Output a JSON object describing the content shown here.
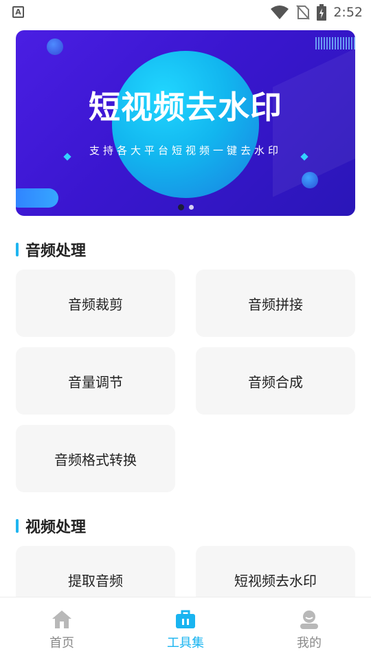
{
  "status_bar": {
    "time": "2:52",
    "icons": [
      "text-a-icon",
      "wifi-icon",
      "no-sim-icon",
      "battery-charging-icon"
    ]
  },
  "banner": {
    "title": "短视频去水印",
    "subtitle": "支持各大平台短视频一键去水印",
    "page_count": 2,
    "active_page": 1
  },
  "sections": [
    {
      "title": "音频处理",
      "items": [
        "音频裁剪",
        "音频拼接",
        "音量调节",
        "音频合成",
        "音频格式转换"
      ]
    },
    {
      "title": "视频处理",
      "items": [
        "提取音频",
        "短视频去水印"
      ]
    }
  ],
  "bottom_nav": [
    {
      "label": "首页",
      "icon": "home-icon",
      "active": false
    },
    {
      "label": "工具集",
      "icon": "toolbox-icon",
      "active": true
    },
    {
      "label": "我的",
      "icon": "profile-icon",
      "active": false
    }
  ],
  "colors": {
    "accent": "#19b4f0",
    "inactive": "#8a8a8a",
    "card_bg": "#f6f6f6",
    "banner_bg": "#3a16cf"
  }
}
